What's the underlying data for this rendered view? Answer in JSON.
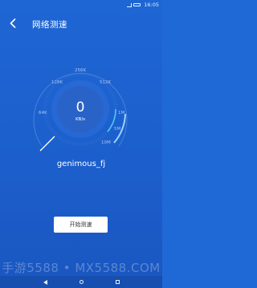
{
  "status_bar": {
    "time": "16:05"
  },
  "app_bar": {
    "title": "网络测速",
    "back_icon": "back-arrow-icon"
  },
  "gauge": {
    "value": "0",
    "unit": "KB/s",
    "tick_labels": [
      "64K",
      "128K",
      "256K",
      "512K",
      "1M",
      "5M",
      "10M"
    ],
    "needle_level": 0,
    "colors": {
      "arc": "#5d8ee3",
      "active_arc": "#4fd3ff",
      "center": "#2a63c8",
      "inner_ring": "#2f6fd8"
    }
  },
  "network": {
    "ssid": "genimous_fj"
  },
  "actions": {
    "start_label": "开始测速"
  },
  "watermark": {
    "text": "手游5588 • MX5588.COM"
  }
}
